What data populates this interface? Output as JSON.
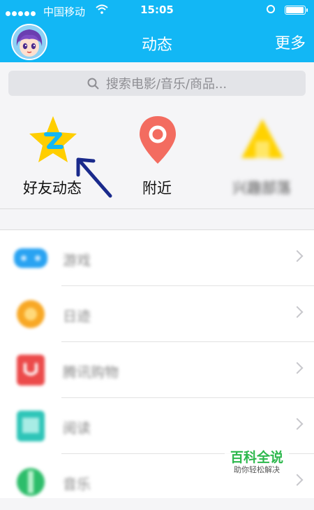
{
  "status_bar": {
    "carrier": "中国移动",
    "time": "15:05",
    "battery_level": 0.9
  },
  "header": {
    "title": "动态",
    "more_label": "更多",
    "avatar_icon": "cartoon-avatar-icon"
  },
  "search": {
    "placeholder": "搜索电影/音乐/商品..."
  },
  "quick_actions": [
    {
      "label": "好友动态",
      "icon": "qzone-star-icon",
      "color": "#ffce00"
    },
    {
      "label": "附近",
      "icon": "location-pin-icon",
      "color": "#f36c60"
    },
    {
      "label": "兴趣部落",
      "icon": "tribe-icon",
      "color": "#ffd200"
    }
  ],
  "list": [
    {
      "label": "游戏",
      "icon": "game-icon",
      "color": "#29a3f2"
    },
    {
      "label": "日迹",
      "icon": "moments-icon",
      "color": "#f8a825"
    },
    {
      "label": "腾讯购物",
      "icon": "shopping-bag-icon",
      "color": "#ec4b4b"
    },
    {
      "label": "阅读",
      "icon": "book-icon",
      "color": "#2ec5b8"
    },
    {
      "label": "音乐",
      "icon": "music-icon",
      "color": "#2dbd6a"
    }
  ],
  "watermark": {
    "main": "百科全说",
    "sub": "助你轻松解决"
  },
  "colors": {
    "accent": "#12b7f5",
    "background": "#f5f5f7"
  }
}
